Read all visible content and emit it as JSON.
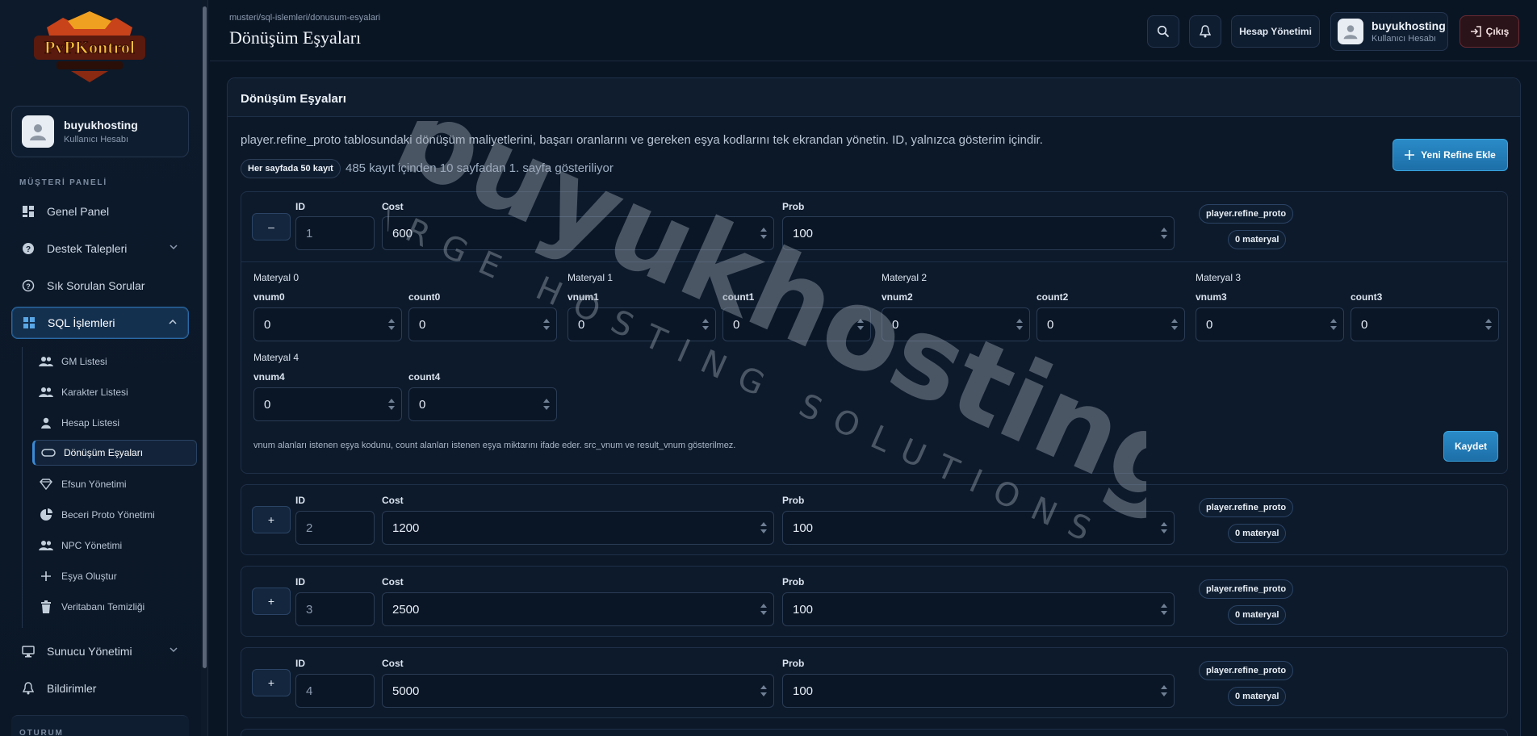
{
  "sidebar": {
    "user": {
      "name": "buyukhosting",
      "role": "Kullanıcı Hesabı"
    },
    "section_label": "MÜŞTERİ PANELİ",
    "items": [
      {
        "label": "Genel Panel"
      },
      {
        "label": "Destek Talepleri"
      },
      {
        "label": "Sık Sorulan Sorular"
      },
      {
        "label": "SQL İşlemleri"
      }
    ],
    "sub_items": [
      {
        "label": "GM Listesi"
      },
      {
        "label": "Karakter Listesi"
      },
      {
        "label": "Hesap Listesi"
      },
      {
        "label": "Dönüşüm Eşyaları"
      },
      {
        "label": "Efsun Yönetimi"
      },
      {
        "label": "Beceri Proto Yönetimi"
      },
      {
        "label": "NPC Yönetimi"
      },
      {
        "label": "Eşya Oluştur"
      },
      {
        "label": "Veritabanı Temizliği"
      }
    ],
    "items_bottom": [
      {
        "label": "Sunucu Yönetimi"
      },
      {
        "label": "Bildirimler"
      }
    ],
    "bottom_section_label": "OTURUM"
  },
  "topbar": {
    "breadcrumb": "musteri/sql-islemleri/donusum-esyalari",
    "title": "Dönüşüm Eşyaları",
    "account_button": "Hesap Yönetimi",
    "user": {
      "name": "buyukhosting",
      "role": "Kullanıcı Hesabı"
    },
    "logout": "Çıkış"
  },
  "card": {
    "title": "Dönüşüm Eşyaları",
    "description": "player.refine_proto tablosundaki dönüşüm maliyetlerini, başarı oranlarını ve gereken eşya kodlarını tek ekrandan yönetin. ID, yalnızca gösterim içindir.",
    "per_page_pill": "Her sayfada 50 kayıt",
    "count_text": "485 kayıt içinden 10 sayfadan 1. sayfa gösteriliyor",
    "new_button": "Yeni Refine Ekle"
  },
  "labels": {
    "id": "ID",
    "cost": "Cost",
    "prob": "Prob",
    "table_tag": "player.refine_proto",
    "material_tag": "0 materyal",
    "save": "Kaydet",
    "note": "vnum alanları istenen eşya kodunu, count alanları istenen eşya miktarını ifade eder. src_vnum ve result_vnum gösterilmez."
  },
  "rows": [
    {
      "toggle": "–",
      "id": "1",
      "cost": "600",
      "prob": "100"
    },
    {
      "toggle": "+",
      "id": "2",
      "cost": "1200",
      "prob": "100"
    },
    {
      "toggle": "+",
      "id": "3",
      "cost": "2500",
      "prob": "100"
    },
    {
      "toggle": "+",
      "id": "4",
      "cost": "5000",
      "prob": "100"
    }
  ],
  "materials": [
    {
      "title": "Materyal 0",
      "vnum_label": "vnum0",
      "count_label": "count0",
      "vnum": "0",
      "count": "0"
    },
    {
      "title": "Materyal 1",
      "vnum_label": "vnum1",
      "count_label": "count1",
      "vnum": "0",
      "count": "0"
    },
    {
      "title": "Materyal 2",
      "vnum_label": "vnum2",
      "count_label": "count2",
      "vnum": "0",
      "count": "0"
    },
    {
      "title": "Materyal 3",
      "vnum_label": "vnum3",
      "count_label": "count3",
      "vnum": "0",
      "count": "0"
    },
    {
      "title": "Materyal 4",
      "vnum_label": "vnum4",
      "count_label": "count4",
      "vnum": "0",
      "count": "0"
    }
  ],
  "watermark": {
    "main": "buyukhosting",
    "sub": "LARGE HOSTING SOLUTIONS"
  },
  "colors": {
    "accent": "#2a8bc7",
    "background": "#0a1524",
    "danger": "#6b2a33"
  }
}
